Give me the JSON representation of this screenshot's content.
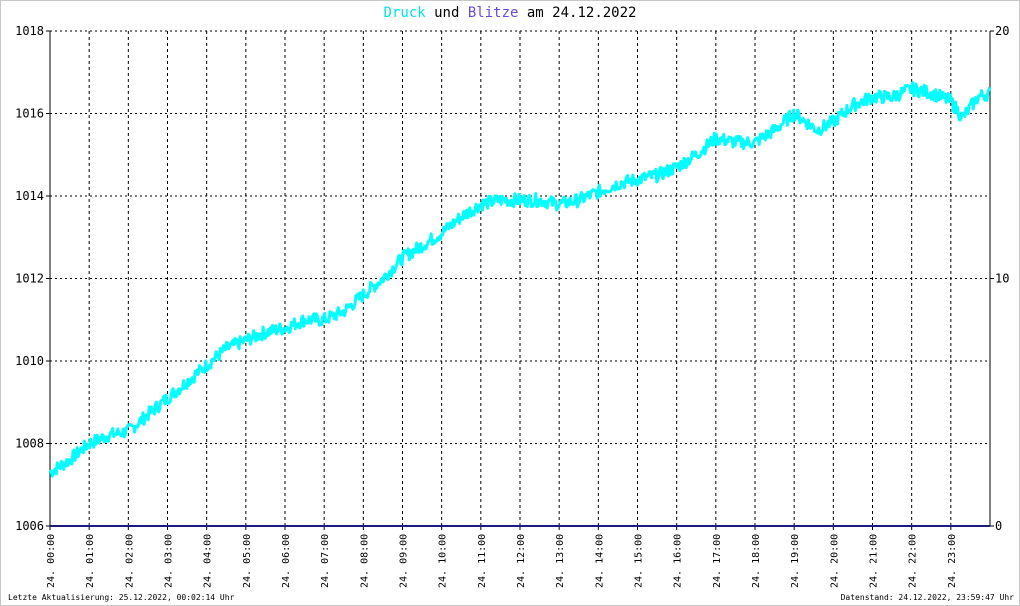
{
  "title": {
    "series1": "Druck",
    "conj": "und",
    "series2": "Blitze",
    "date_prefix": "am",
    "date": "24.12.2022"
  },
  "footer": {
    "left": "Letzte Aktualisierung: 25.12.2022, 00:02:14 Uhr",
    "right": "Datenstand: 24.12.2022, 23:59:47 Uhr"
  },
  "colors": {
    "druck": "#00ffff",
    "blitze": "#1a1a80",
    "title_druck": "#00e5e5",
    "title_blitze": "#6a4ad8",
    "grid": "#000000"
  },
  "chart_data": {
    "type": "line",
    "x_unit": "hour of day",
    "xlim": [
      0,
      24
    ],
    "x_ticks": [
      "24. 00:00",
      "24. 01:00",
      "24. 02:00",
      "24. 03:00",
      "24. 04:00",
      "24. 05:00",
      "24. 06:00",
      "24. 07:00",
      "24. 08:00",
      "24. 09:00",
      "24. 10:00",
      "24. 11:00",
      "24. 12:00",
      "24. 13:00",
      "24. 14:00",
      "24. 15:00",
      "24. 16:00",
      "24. 17:00",
      "24. 18:00",
      "24. 19:00",
      "24. 20:00",
      "24. 21:00",
      "24. 22:00",
      "24. 23:00"
    ],
    "y_left": {
      "ylim": [
        1006,
        1018
      ],
      "ticks": [
        "1006",
        "1008",
        "1010",
        "1012",
        "1014",
        "1016",
        "1018"
      ]
    },
    "y_right": {
      "ylim": [
        0,
        20
      ],
      "ticks": [
        "0",
        "10",
        "20"
      ]
    },
    "grid": true,
    "series": [
      {
        "name": "Druck",
        "axis": "left",
        "x": [
          0,
          0.5,
          1,
          1.5,
          2,
          2.5,
          3,
          3.5,
          4,
          4.5,
          5,
          5.5,
          6,
          6.5,
          7,
          7.5,
          8,
          8.5,
          9,
          9.5,
          10,
          10.5,
          11,
          11.5,
          12,
          12.5,
          13,
          13.5,
          14,
          14.5,
          15,
          15.5,
          16,
          16.5,
          17,
          17.5,
          18,
          18.5,
          19,
          19.3,
          19.6,
          20,
          20.5,
          21,
          21.5,
          22,
          22.5,
          23,
          23.3,
          23.7,
          24
        ],
        "y": [
          1007.3,
          1007.6,
          1008.0,
          1008.2,
          1008.3,
          1008.7,
          1009.1,
          1009.5,
          1009.9,
          1010.3,
          1010.5,
          1010.7,
          1010.8,
          1011.0,
          1011.0,
          1011.2,
          1011.6,
          1012.0,
          1012.5,
          1012.8,
          1013.1,
          1013.5,
          1013.8,
          1013.9,
          1013.9,
          1013.9,
          1013.8,
          1013.9,
          1014.1,
          1014.3,
          1014.4,
          1014.5,
          1014.7,
          1015.0,
          1015.4,
          1015.3,
          1015.3,
          1015.6,
          1016.0,
          1015.8,
          1015.6,
          1015.8,
          1016.2,
          1016.4,
          1016.4,
          1016.6,
          1016.5,
          1016.3,
          1015.9,
          1016.4,
          1016.5
        ]
      },
      {
        "name": "Blitze",
        "axis": "right",
        "x": [
          0,
          24
        ],
        "y": [
          0,
          0
        ]
      }
    ]
  }
}
